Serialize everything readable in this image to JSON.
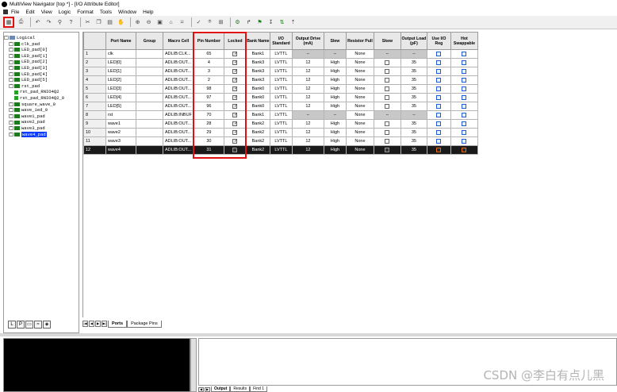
{
  "window": {
    "title": "MultiView Navigator [top *] - [I/O Attribute Editor]"
  },
  "menu": [
    "File",
    "Edit",
    "View",
    "Logic",
    "Format",
    "Tools",
    "Window",
    "Help"
  ],
  "toolbar": {
    "icons": [
      "io-editor-icon",
      "print-icon",
      "undo-icon",
      "redo-icon",
      "find-icon",
      "help-icon",
      "cut-icon",
      "copy-icon",
      "paste-icon",
      "pan-icon",
      "zoom-in-icon",
      "zoom-out-icon",
      "fit-icon",
      "lock-icon",
      "unlock-icon",
      "check-icon",
      "filter-icon",
      "pin-icon",
      "assign-icon",
      "route-icon",
      "flag-icon",
      "sort-icon",
      "sort-desc-icon"
    ]
  },
  "tree": {
    "root": "Logical",
    "items": [
      {
        "label": "clk_pad",
        "type": "bus"
      },
      {
        "label": "LED_pad[0]",
        "type": "bus"
      },
      {
        "label": "LED_pad[1]",
        "type": "bus"
      },
      {
        "label": "LED_pad[2]",
        "type": "bus"
      },
      {
        "label": "LED_pad[3]",
        "type": "bus"
      },
      {
        "label": "LED_pad[4]",
        "type": "bus"
      },
      {
        "label": "LED_pad[5]",
        "type": "bus"
      },
      {
        "label": "rst_pad",
        "type": "bus"
      },
      {
        "label": "rst_pad_RNIO4Q2",
        "type": "pin"
      },
      {
        "label": "rst_pad_RNIO4Q2_0",
        "type": "pin"
      },
      {
        "label": "square_wave_0",
        "type": "bus"
      },
      {
        "label": "wave_1ed_0",
        "type": "bus"
      },
      {
        "label": "wave1_pad",
        "type": "bus"
      },
      {
        "label": "wave2_pad",
        "type": "bus"
      },
      {
        "label": "wave3_pad",
        "type": "bus"
      },
      {
        "label": "wave4_pad",
        "type": "bus",
        "selected": true
      }
    ],
    "tabs": [
      "logical-tab",
      "physical-tab",
      "ports-tab",
      "nets-tab",
      "instances-tab"
    ]
  },
  "table": {
    "headers": [
      "Port Name",
      "Group",
      "Macro Cell",
      "Pin Number",
      "Locked",
      "Bank Name",
      "I/O Standard",
      "Output Drive (mA)",
      "Slew",
      "Resistor Pull",
      "Skew",
      "Output Load (pF)",
      "Use I/O Reg",
      "Hot Swappable"
    ],
    "rows": [
      {
        "n": "1",
        "port": "clk",
        "macro": "ADLIB:CLK...",
        "pin": "65",
        "bank": "Bank1",
        "std": "LVTTL",
        "drive": "--",
        "slew": "--",
        "pull": "None",
        "skew": "--",
        "load": "--"
      },
      {
        "n": "2",
        "port": "LED[0]",
        "macro": "ADLIB:OUT...",
        "pin": "4",
        "bank": "Bank3",
        "std": "LVTTL",
        "drive": "12",
        "slew": "High",
        "pull": "None",
        "skew": "",
        "load": "35"
      },
      {
        "n": "3",
        "port": "LED[1]",
        "macro": "ADLIB:OUT...",
        "pin": "3",
        "bank": "Bank3",
        "std": "LVTTL",
        "drive": "12",
        "slew": "High",
        "pull": "None",
        "skew": "",
        "load": "35"
      },
      {
        "n": "4",
        "port": "LED[2]",
        "macro": "ADLIB:OUT...",
        "pin": "2",
        "bank": "Bank3",
        "std": "LVTTL",
        "drive": "12",
        "slew": "High",
        "pull": "None",
        "skew": "",
        "load": "35"
      },
      {
        "n": "5",
        "port": "LED[3]",
        "macro": "ADLIB:OUT...",
        "pin": "98",
        "bank": "Bank0",
        "std": "LVTTL",
        "drive": "12",
        "slew": "High",
        "pull": "None",
        "skew": "",
        "load": "35"
      },
      {
        "n": "6",
        "port": "LED[4]",
        "macro": "ADLIB:OUT...",
        "pin": "97",
        "bank": "Bank0",
        "std": "LVTTL",
        "drive": "12",
        "slew": "High",
        "pull": "None",
        "skew": "",
        "load": "35"
      },
      {
        "n": "7",
        "port": "LED[5]",
        "macro": "ADLIB:OUT...",
        "pin": "96",
        "bank": "Bank0",
        "std": "LVTTL",
        "drive": "12",
        "slew": "High",
        "pull": "None",
        "skew": "",
        "load": "35"
      },
      {
        "n": "8",
        "port": "rst",
        "macro": "ADLIB:INBUF",
        "pin": "70",
        "bank": "Bank1",
        "std": "LVTTL",
        "drive": "--",
        "slew": "--",
        "pull": "None",
        "skew": "--",
        "load": "--"
      },
      {
        "n": "9",
        "port": "wave1",
        "macro": "ADLIB:OUT...",
        "pin": "28",
        "bank": "Bank2",
        "std": "LVTTL",
        "drive": "12",
        "slew": "High",
        "pull": "None",
        "skew": "",
        "load": "35"
      },
      {
        "n": "10",
        "port": "wave2",
        "macro": "ADLIB:OUT...",
        "pin": "29",
        "bank": "Bank2",
        "std": "LVTTL",
        "drive": "12",
        "slew": "High",
        "pull": "None",
        "skew": "",
        "load": "35"
      },
      {
        "n": "11",
        "port": "wave3",
        "macro": "ADLIB:OUT...",
        "pin": "30",
        "bank": "Bank2",
        "std": "LVTTL",
        "drive": "12",
        "slew": "High",
        "pull": "None",
        "skew": "",
        "load": "35"
      },
      {
        "n": "12",
        "port": "wave4",
        "macro": "ADLIB:OUT...",
        "pin": "31",
        "bank": "Bank2",
        "std": "LVTTL",
        "drive": "12",
        "slew": "High",
        "pull": "None",
        "skew": "",
        "load": "35"
      }
    ],
    "tabs": [
      "Ports",
      "Package Pins"
    ]
  },
  "output": {
    "tabs": [
      "Output",
      "Results",
      "Find 1"
    ]
  },
  "watermark": "CSDN @李白有点儿黑",
  "colors": {
    "highlight": "#e01010",
    "selection": "#0a3cff"
  }
}
